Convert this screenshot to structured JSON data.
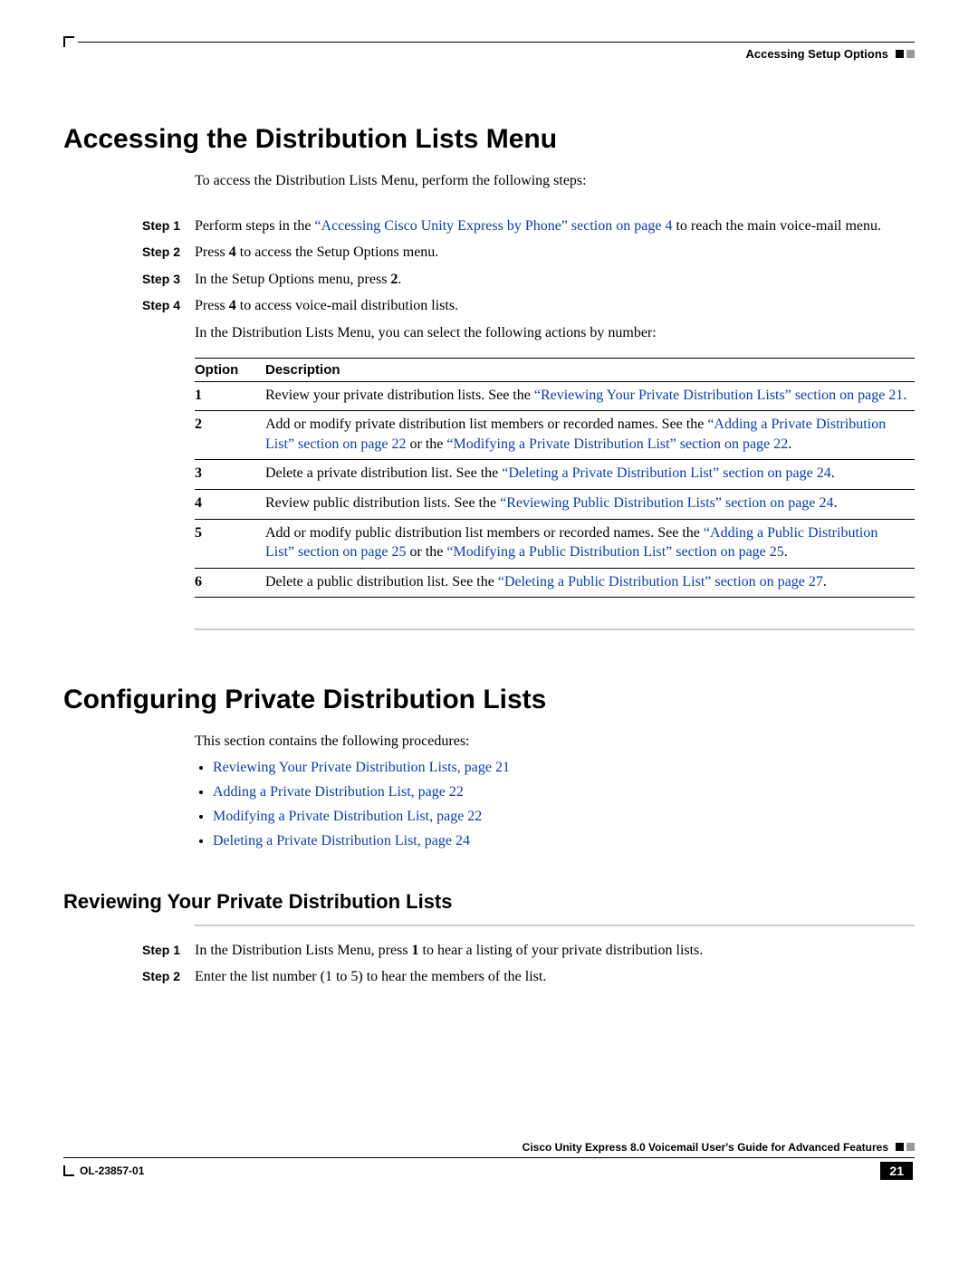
{
  "header": {
    "section_label": "Accessing Setup Options"
  },
  "s1": {
    "title": "Accessing the Distribution Lists Menu",
    "intro": "To access the Distribution Lists Menu, perform the following steps:",
    "steps": {
      "l1": "Step 1",
      "t1a": "Perform steps in the ",
      "t1_link": "“Accessing Cisco Unity Express by Phone” section on page 4",
      "t1b": " to reach the main voice-mail menu.",
      "l2": "Step 2",
      "t2a": "Press ",
      "t2_key": "4",
      "t2b": " to access the Setup Options menu.",
      "l3": "Step 3",
      "t3a": "In the Setup Options menu, press ",
      "t3_key": "2",
      "t3b": ".",
      "l4": "Step 4",
      "t4a": "Press ",
      "t4_key": "4",
      "t4b": " to access voice-mail distribution lists.",
      "sub": "In the Distribution Lists Menu, you can select the following actions by number:"
    },
    "table": {
      "h_option": "Option",
      "h_desc": "Description",
      "o1": "1",
      "d1a": "Review your private distribution lists. See the ",
      "d1_link": "“Reviewing Your Private Distribution Lists” section on page 21",
      "d1b": ".",
      "o2": "2",
      "d2a": "Add or modify private distribution list members or recorded names. See the ",
      "d2_link1": "“Adding a Private Distribution List” section on page 22",
      "d2b": " or the ",
      "d2_link2": "“Modifying a Private Distribution List” section on page 22",
      "d2c": ".",
      "o3": "3",
      "d3a": "Delete a private distribution list. See the ",
      "d3_link": "“Deleting a Private Distribution List” section on page 24",
      "d3b": ".",
      "o4": "4",
      "d4a": "Review public distribution lists. See the ",
      "d4_link": "“Reviewing Public Distribution Lists” section on page 24",
      "d4b": ".",
      "o5": "5",
      "d5a": "Add or modify public distribution list members or recorded names. See the ",
      "d5_link1": "“Adding a Public Distribution List” section on page 25",
      "d5b": " or the ",
      "d5_link2": "“Modifying a Public Distribution List” section on page 25",
      "d5c": ".",
      "o6": "6",
      "d6a": "Delete a public distribution list. See the ",
      "d6_link": "“Deleting a Public Distribution List” section on page 27",
      "d6b": "."
    }
  },
  "s2": {
    "title": "Configuring Private Distribution Lists",
    "intro": "This section contains the following procedures:",
    "b1": "Reviewing Your Private Distribution Lists, page 21",
    "b2": "Adding a Private Distribution List, page 22",
    "b3": "Modifying a Private Distribution List, page 22",
    "b4": "Deleting a Private Distribution List, page 24"
  },
  "s3": {
    "title": "Reviewing Your Private Distribution Lists",
    "l1": "Step 1",
    "t1a": "In the Distribution Lists Menu, press ",
    "t1_key": "1",
    "t1b": " to hear a listing of your private distribution lists.",
    "l2": "Step 2",
    "t2": "Enter the list number (1 to 5) to hear the members of the list."
  },
  "footer": {
    "guide_title": "Cisco Unity Express 8.0 Voicemail User's Guide for Advanced Features",
    "doc_id": "OL-23857-01",
    "page": "21"
  }
}
